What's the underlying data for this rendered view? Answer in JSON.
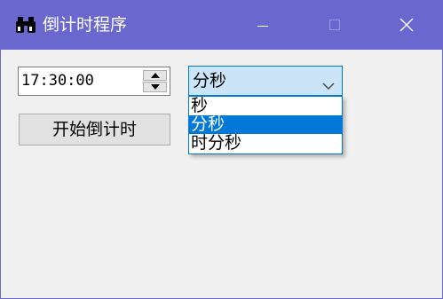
{
  "window": {
    "title": "倒计时程序",
    "icon": "binoculars-icon",
    "controls": [
      "minimize-icon",
      "maximize-icon",
      "close-icon"
    ],
    "accent_color": "#6a67cf"
  },
  "time_input": {
    "value": "17:30:00"
  },
  "format_select": {
    "selected": "分秒",
    "options": [
      "秒",
      "分秒",
      "时分秒"
    ],
    "highlighted_index": 1,
    "highlight_color": "#0078d7"
  },
  "start_button": {
    "label": "开始倒计时"
  }
}
